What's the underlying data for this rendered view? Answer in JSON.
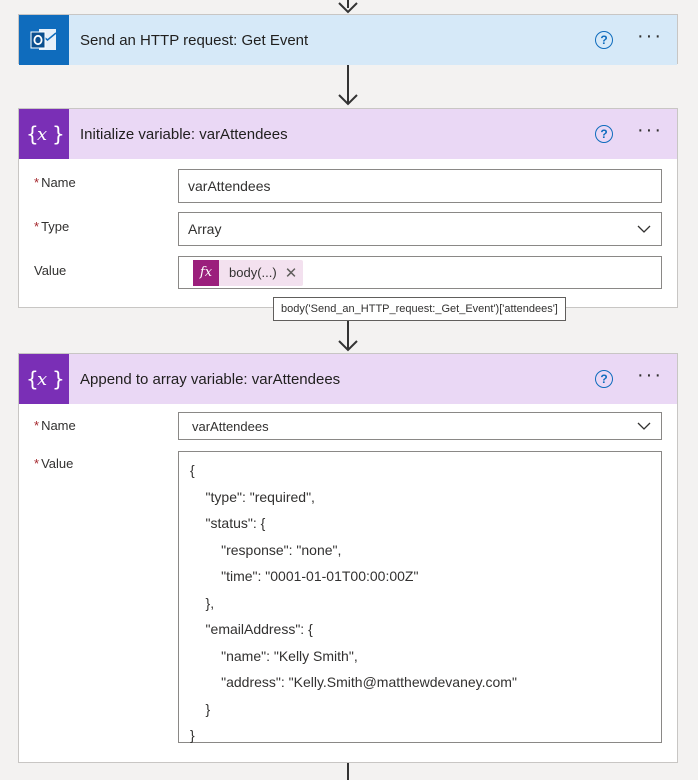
{
  "http_card": {
    "title": "Send an HTTP request: Get Event",
    "help": "?",
    "more": "···"
  },
  "init_card": {
    "title": "Initialize variable: varAttendees",
    "help": "?",
    "more": "···",
    "required_mark": "*",
    "name_label": "Name",
    "name_value": "varAttendees",
    "type_label": "Type",
    "type_value": "Array",
    "value_label": "Value",
    "token_fx": "fx",
    "token_text": "body(...)",
    "token_remove": "✕",
    "tooltip": "body('Send_an_HTTP_request:_Get_Event')['attendees']"
  },
  "append_card": {
    "title": "Append to array variable: varAttendees",
    "help": "?",
    "more": "···",
    "required_mark": "*",
    "name_label": "Name",
    "name_value": "varAttendees",
    "value_label": "Value",
    "code_lines": [
      "{",
      "    \"type\": \"required\",",
      "    \"status\": {",
      "        \"response\": \"none\",",
      "        \"time\": \"0001-01-01T00:00:00Z\"",
      "    },",
      "    \"emailAddress\": {",
      "        \"name\": \"Kelly Smith\",",
      "        \"address\": \"Kelly.Smith@matthewdevaney.com\"",
      "    }",
      "}"
    ]
  },
  "colors": {
    "outlook_blue": "#0f6cbd",
    "variable_purple": "#7a2fb6",
    "http_header_bg": "#d6e9f8",
    "variable_header_bg": "#ead8f5",
    "token_magenta": "#9b1f7c",
    "required_red": "#a4262c"
  }
}
